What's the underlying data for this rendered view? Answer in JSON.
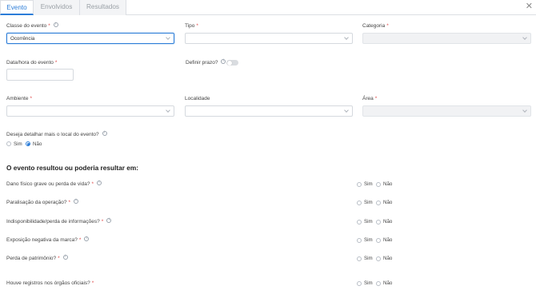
{
  "tabs": [
    {
      "label": "Evento",
      "active": true
    },
    {
      "label": "Envolvidos",
      "active": false
    },
    {
      "label": "Resultados",
      "active": false
    }
  ],
  "close_icon": "close-icon",
  "fields": {
    "classe": {
      "label": "Classe do evento",
      "value": "Ocorrência"
    },
    "tipo": {
      "label": "Tipo",
      "value": ""
    },
    "categoria": {
      "label": "Categoria",
      "value": ""
    },
    "data_hora": {
      "label": "Data/hora do evento",
      "value": ""
    },
    "prazo": {
      "label": "Definir prazo?",
      "enabled": false
    },
    "ambiente": {
      "label": "Ambiente",
      "value": ""
    },
    "localidade": {
      "label": "Localidade",
      "value": ""
    },
    "area": {
      "label": "Área",
      "value": ""
    },
    "detalhar": {
      "label": "Deseja detalhar mais o local do evento?",
      "yes": "Sim",
      "no": "Não",
      "selected": "Não"
    }
  },
  "required_mark": "*",
  "section_title": "O evento resultou ou poderia resultar em:",
  "questions": [
    {
      "label": "Dano físico grave ou perda de vida?",
      "yes": "Sim",
      "no": "Não",
      "info": true
    },
    {
      "label": "Paralisação da operação?",
      "yes": "Sim",
      "no": "Não",
      "info": true
    },
    {
      "label": "Indisponibilidade/perda de informações?",
      "yes": "Sim",
      "no": "Não",
      "info": true
    },
    {
      "label": "Exposição negativa da marca?",
      "yes": "Sim",
      "no": "Não",
      "info": true
    },
    {
      "label": "Perda de patrimônio?",
      "yes": "Sim",
      "no": "Não",
      "info": true
    },
    {
      "label": "Houve registros nos órgãos oficiais?",
      "yes": "Sim",
      "no": "Não",
      "info": false
    }
  ],
  "colors": {
    "accent": "#2c7dd8",
    "required": "#e14a4a"
  }
}
